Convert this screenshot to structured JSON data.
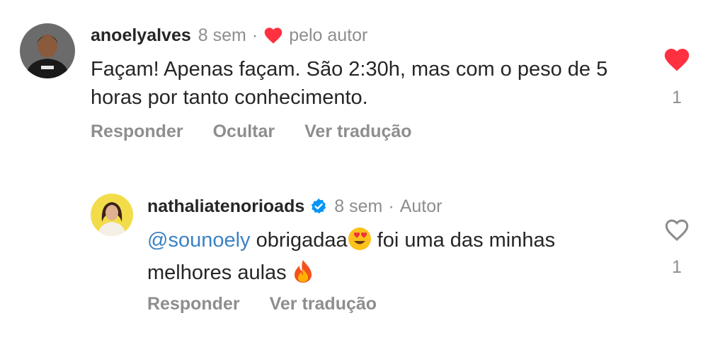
{
  "comments": [
    {
      "username": "anoelyalves",
      "time": "8 sem",
      "separator": "·",
      "liked_by_author": "pelo autor",
      "text": "Façam! Apenas façam. São 2:30h, mas com o peso de 5 horas por tanto conhecimento.",
      "actions": [
        "Responder",
        "Ocultar",
        "Ver tradução"
      ],
      "likes": "1",
      "liked": true
    },
    {
      "username": "nathaliatenorioads",
      "verified": true,
      "time": "8 sem",
      "separator": "·",
      "role": "Autor",
      "mention": "@sounoely",
      "text_1": " obrigadaa",
      "text_2": "  foi uma das minhas melhores aulas ",
      "emoji_1": "heart-eyes-emoji",
      "emoji_2": "fire-emoji",
      "actions": [
        "Responder",
        "Ver tradução"
      ],
      "likes": "1",
      "liked": false
    }
  ],
  "colors": {
    "like_red": "#ff3040",
    "verified_blue": "#0095f6",
    "mention_blue": "#3b82c4",
    "secondary_text": "#8e8e8e"
  }
}
